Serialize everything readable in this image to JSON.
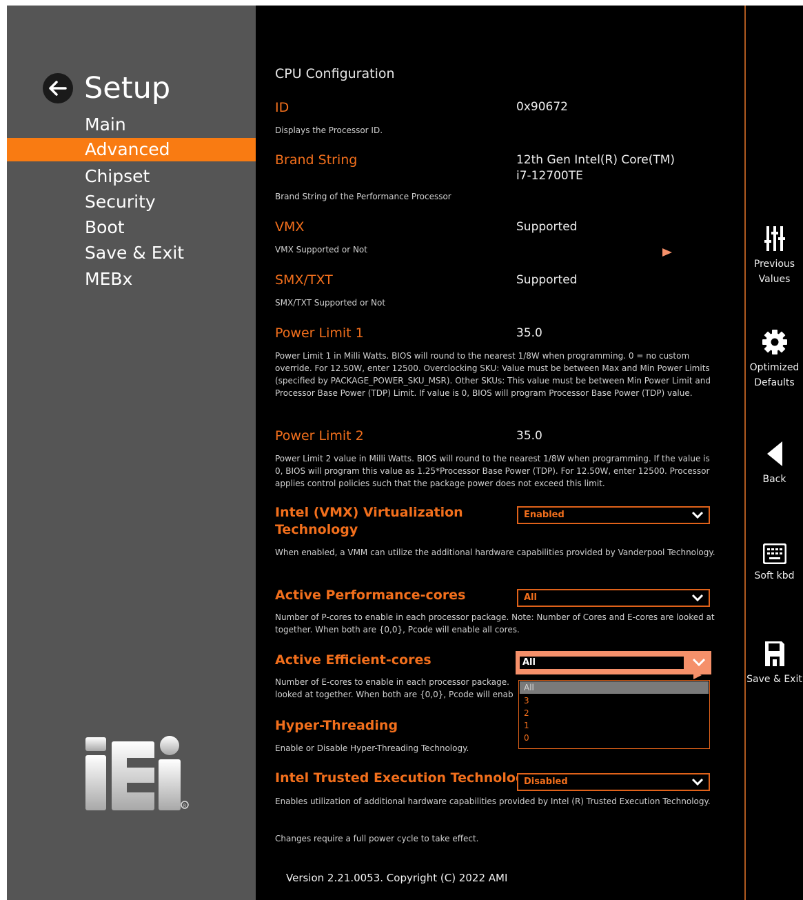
{
  "sidebar": {
    "title": "Setup",
    "menu": [
      "Main",
      "Advanced",
      "Chipset",
      "Security",
      "Boot",
      "Save & Exit",
      "MEBx"
    ],
    "active": "Advanced"
  },
  "main": {
    "section_title": "CPU Configuration",
    "id": {
      "label": "ID",
      "value": "0x90672",
      "help": "Displays the Processor ID."
    },
    "brand": {
      "label": "Brand String",
      "value_line1": "12th Gen Intel(R) Core(TM)",
      "value_line2": "i7-12700TE",
      "help": "Brand String of the Performance Processor"
    },
    "vmx": {
      "label": "VMX",
      "value": "Supported",
      "help": "VMX Supported or Not"
    },
    "smx": {
      "label": "SMX/TXT",
      "value": "Supported",
      "help": "SMX/TXT Supported or Not"
    },
    "pl1": {
      "label": "Power Limit 1",
      "value": "35.0",
      "help": "Power Limit 1 in Milli Watts. BIOS will round to the nearest 1/8W when programming. 0 = no custom override. For 12.50W, enter 12500. Overclocking SKU: Value must be between Max and Min Power Limits (specified by PACKAGE_POWER_SKU_MSR). Other SKUs: This value must be between Min Power Limit and Processor Base Power (TDP) Limit. If value is 0, BIOS will program Processor Base Power (TDP) value."
    },
    "pl2": {
      "label": "Power Limit 2",
      "value": "35.0",
      "help": "Power Limit 2 value in Milli Watts. BIOS will round to the nearest 1/8W when programming. If the value is 0, BIOS will program this value as 1.25*Processor Base Power (TDP). For 12.50W, enter 12500. Processor applies control policies such that the package power does not exceed this limit."
    },
    "virt": {
      "label_line1": "Intel (VMX) Virtualization",
      "label_line2": "Technology",
      "value": "Enabled",
      "help": "When enabled, a VMM can utilize the additional hardware capabilities provided by Vanderpool Technology."
    },
    "pcores": {
      "label": "Active Performance-cores",
      "value": "All",
      "help": "Number of P-cores to enable in each processor package. Note: Number of Cores and E-cores are looked at together. When both are {0,0}, Pcode will enable all cores."
    },
    "ecores": {
      "label": "Active Efficient-cores",
      "value": "All",
      "help_line1": "Number of E-cores to enable in each processor package.",
      "help_line2": "looked at together. When both are {0,0}, Pcode will enab",
      "options": [
        "All",
        "3",
        "2",
        "1",
        "0"
      ]
    },
    "ht": {
      "label": "Hyper-Threading",
      "help": "Enable or Disable Hyper-Threading Technology."
    },
    "txt": {
      "label": "Intel Trusted Execution Technology",
      "value": "Disabled",
      "help": "Enables utilization of additional hardware capabilities provided by Intel (R) Trusted Execution Technology.",
      "note": "Changes require a full power cycle to take effect."
    },
    "version": "Version 2.21.0053. Copyright (C) 2022 AMI"
  },
  "toolbar": {
    "previous_line1": "Previous",
    "previous_line2": "Values",
    "optimized_line1": "Optimized",
    "optimized_line2": "Defaults",
    "back": "Back",
    "softkbd": "Soft kbd",
    "save_exit": "Save & Exit"
  },
  "colors": {
    "accent": "#f97b12",
    "sidebar": "#555555",
    "background": "#000000",
    "dropdown_open": "#f5906a"
  }
}
